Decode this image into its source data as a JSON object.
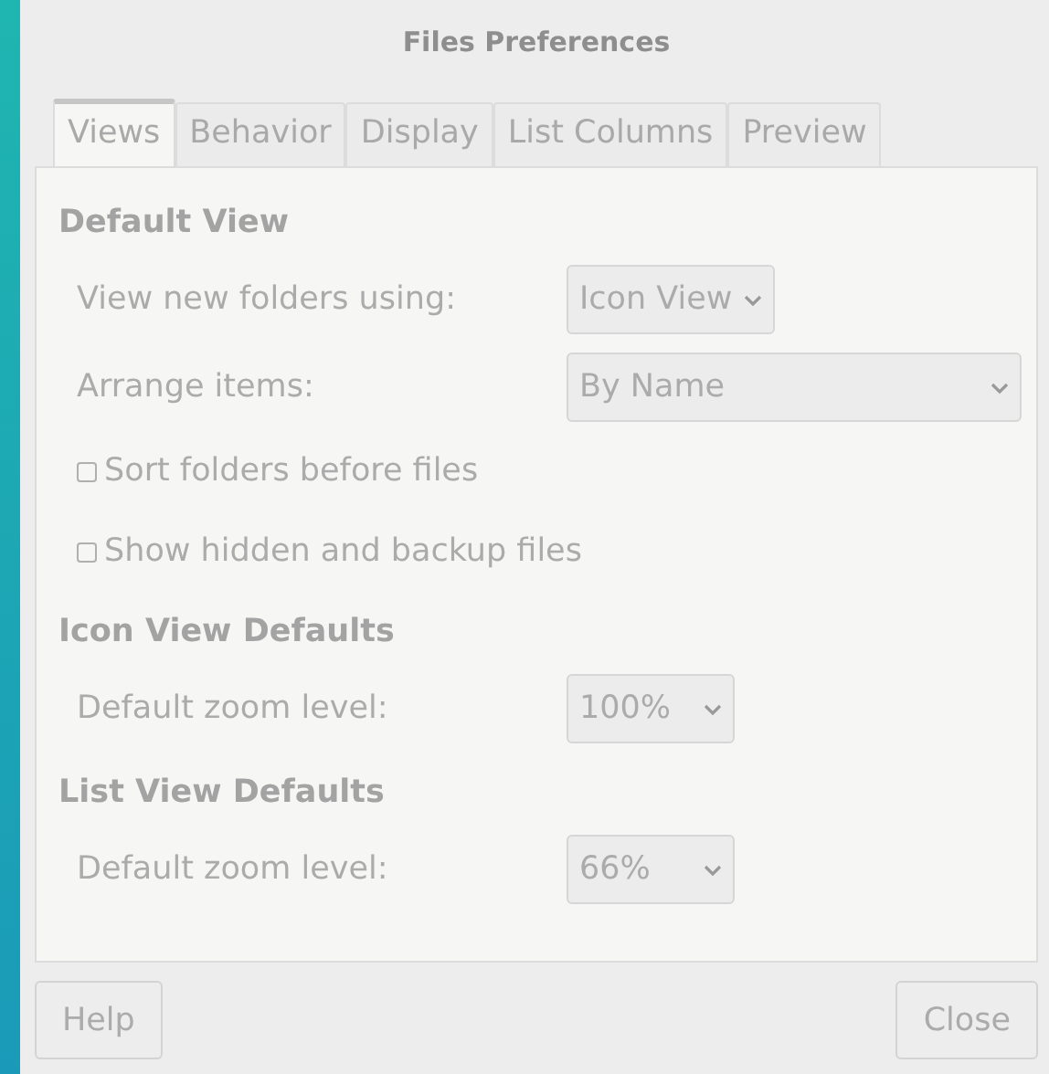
{
  "window": {
    "title": "Files Preferences"
  },
  "tabs": [
    {
      "label": "Views",
      "selected": true
    },
    {
      "label": "Behavior",
      "selected": false
    },
    {
      "label": "Display",
      "selected": false
    },
    {
      "label": "List Columns",
      "selected": false
    },
    {
      "label": "Preview",
      "selected": false
    }
  ],
  "sections": [
    {
      "heading": "Default View",
      "rows": [
        {
          "kind": "combo",
          "label": "View new folders using:",
          "value": "Icon View"
        },
        {
          "kind": "wide_combo",
          "label": "Arrange items:",
          "value": "By Name"
        },
        {
          "kind": "checkbox",
          "label": "Sort folders before files",
          "checked": false
        },
        {
          "kind": "checkbox",
          "label": "Show hidden and backup files",
          "checked": false
        }
      ]
    },
    {
      "heading": "Icon View Defaults",
      "rows": [
        {
          "kind": "combo",
          "label": "Default zoom level:",
          "value": "100%"
        }
      ]
    },
    {
      "heading": "List View Defaults",
      "rows": [
        {
          "kind": "combo",
          "label": "Default zoom level:",
          "value": "66%"
        }
      ]
    }
  ],
  "buttons": [
    "Help",
    "Close"
  ]
}
